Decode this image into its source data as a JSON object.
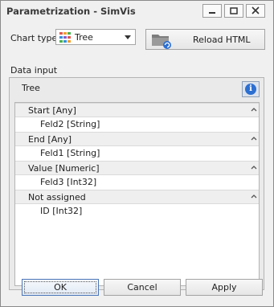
{
  "window": {
    "title": "Parametrization - SimVis"
  },
  "title_buttons": {
    "minimize_icon": "minimize-icon",
    "maximize_icon": "maximize-icon",
    "close_icon": "close-icon"
  },
  "chart_type": {
    "label": "Chart type",
    "selected": "Tree",
    "icon": "tree-chart-icon"
  },
  "reload": {
    "label": "Reload HTML",
    "icon": "folder-refresh-icon"
  },
  "data_input": {
    "label": "Data input",
    "header": "Tree",
    "info_icon": "info-icon",
    "groups": [
      {
        "label": "Start [Any]",
        "items": [
          "Feld2 [String]"
        ]
      },
      {
        "label": "End [Any]",
        "items": [
          "Feld1 [String]"
        ]
      },
      {
        "label": "Value [Numeric]",
        "items": [
          "Feld3 [Int32]"
        ]
      },
      {
        "label": "Not assigned",
        "items": [
          "ID [Int32]"
        ]
      }
    ]
  },
  "footer": {
    "ok": "OK",
    "cancel": "Cancel",
    "apply": "Apply"
  },
  "colors": {
    "accent": "#2c6fd1",
    "ok_border": "#4a75b8"
  }
}
